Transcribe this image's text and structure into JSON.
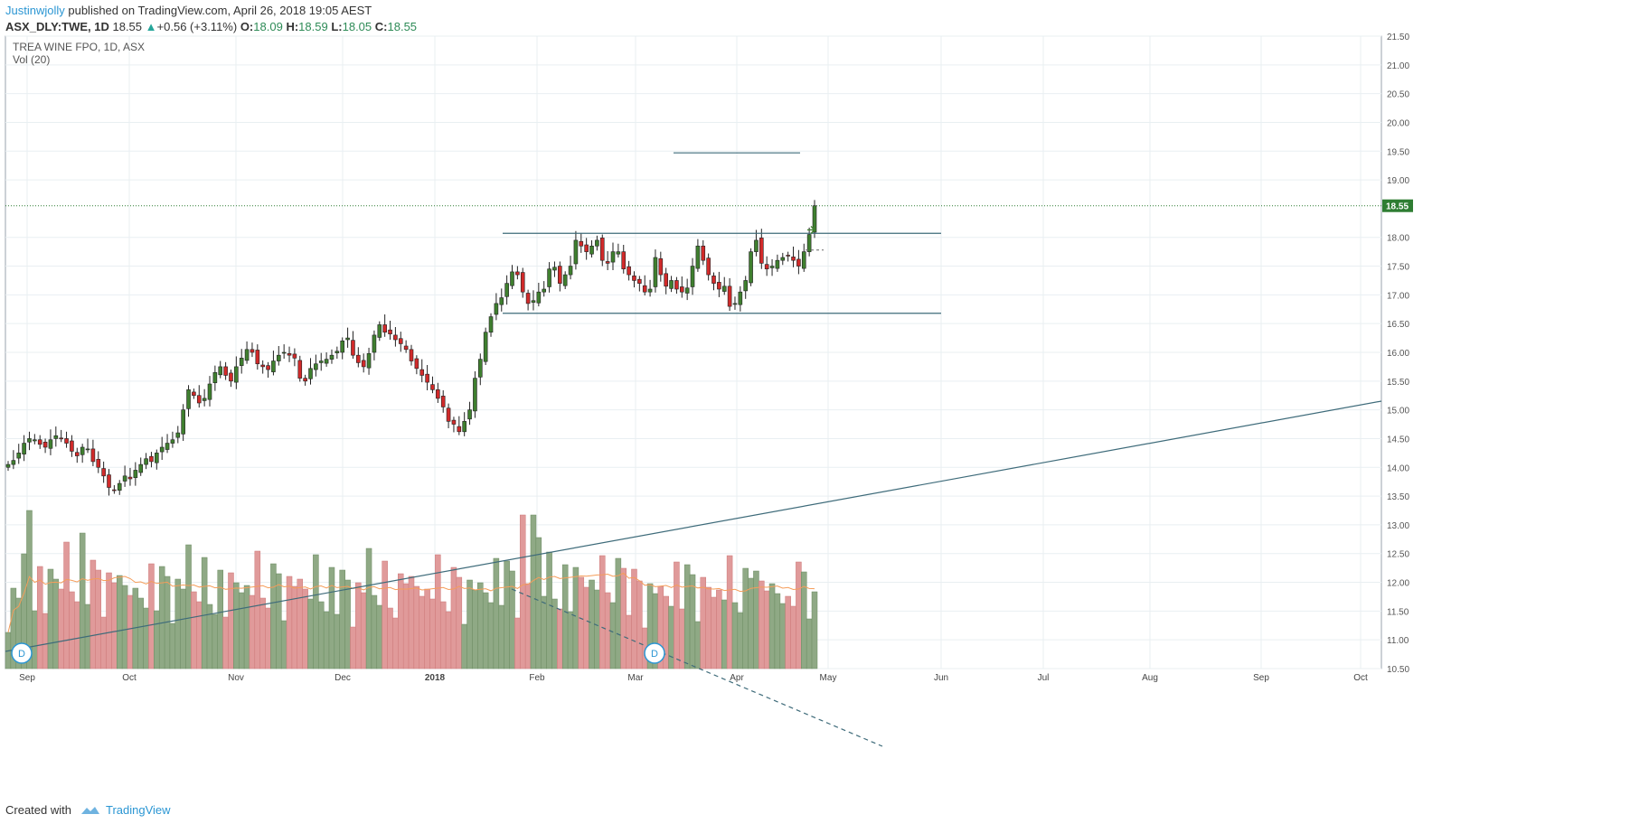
{
  "header": {
    "author": "Justinwjolly",
    "published_text": " published on TradingView.com, April 26, 2018 19:05 AEST",
    "symbol": "ASX_DLY:TWE, 1D",
    "last": "18.55",
    "arrow": "▲",
    "change": "+0.56 (+3.11%)",
    "open_label": "O:",
    "open": "18.09",
    "high_label": "H:",
    "high": "18.59",
    "low_label": "L:",
    "low": "18.05",
    "close_label": "C:",
    "close": "18.55"
  },
  "legend": {
    "title": "TREA WINE FPO, 1D, ASX",
    "volume": "Vol (20)"
  },
  "footer": {
    "created_with": "Created with",
    "brand": "TradingView"
  },
  "colors": {
    "up": "#3f7f2f",
    "down": "#d12a2a",
    "vol_up": "#8fa985",
    "vol_down": "#e09a9a",
    "ma": "#f59d5a",
    "trendline": "#3e6b7a",
    "price_label_bg": "#2e7d32",
    "grid": "#e9eff2"
  },
  "chart_data": {
    "type": "candlestick",
    "title": "TREA WINE FPO, 1D, ASX",
    "ylim": [
      10.5,
      21.5
    ],
    "y_ticks": [
      "21.50",
      "21.00",
      "20.50",
      "20.00",
      "19.50",
      "19.00",
      "18.55",
      "18.00",
      "17.50",
      "17.00",
      "16.50",
      "16.00",
      "15.50",
      "15.00",
      "14.50",
      "14.00",
      "13.50",
      "13.00",
      "12.50",
      "12.00",
      "11.50",
      "11.00",
      "10.50"
    ],
    "x_ticks": [
      "Sep",
      "Oct",
      "Nov",
      "Dec",
      "2018",
      "Feb",
      "Mar",
      "Apr",
      "May",
      "Jun",
      "Jul",
      "Aug",
      "Sep",
      "Oct"
    ],
    "last_price": "18.55",
    "dividend_markers": [
      "D",
      "D"
    ],
    "close": [
      14.05,
      14.12,
      14.25,
      14.42,
      14.5,
      14.48,
      14.4,
      14.35,
      14.48,
      14.55,
      14.5,
      14.42,
      14.28,
      14.2,
      14.35,
      14.32,
      14.1,
      14.0,
      13.85,
      13.65,
      13.6,
      13.72,
      13.85,
      13.8,
      13.95,
      14.05,
      14.15,
      14.1,
      14.25,
      14.35,
      14.42,
      14.48,
      14.6,
      15.0,
      15.35,
      15.25,
      15.12,
      15.2,
      15.45,
      15.65,
      15.75,
      15.6,
      15.5,
      15.75,
      15.9,
      16.05,
      16.0,
      15.8,
      15.75,
      15.7,
      15.85,
      15.95,
      16.0,
      15.95,
      15.9,
      15.55,
      15.5,
      15.72,
      15.8,
      15.85,
      15.88,
      15.95,
      16.02,
      16.2,
      16.25,
      15.95,
      15.82,
      15.75,
      15.98,
      16.3,
      16.48,
      16.35,
      16.32,
      16.22,
      16.15,
      16.05,
      15.85,
      15.72,
      15.6,
      15.48,
      15.35,
      15.2,
      15.05,
      14.8,
      14.75,
      14.62,
      14.8,
      15.0,
      15.55,
      15.88,
      16.35,
      16.62,
      16.85,
      16.95,
      17.2,
      17.4,
      17.35,
      17.05,
      16.85,
      16.9,
      17.05,
      17.1,
      17.45,
      17.48,
      17.2,
      17.35,
      17.5,
      17.95,
      17.85,
      17.75,
      17.85,
      17.95,
      17.6,
      17.55,
      17.75,
      17.75,
      17.45,
      17.35,
      17.25,
      17.2,
      17.05,
      17.1,
      17.65,
      17.35,
      17.15,
      17.25,
      17.1,
      17.05,
      17.12,
      17.5,
      17.85,
      17.6,
      17.35,
      17.2,
      17.1,
      17.15,
      16.8,
      16.85,
      17.05,
      17.25,
      17.75,
      17.95,
      17.55,
      17.45,
      17.5,
      17.6,
      17.65,
      17.68,
      17.6,
      17.5,
      17.75,
      18.05,
      18.55
    ],
    "volume_bars": 164,
    "volume_ma": "Vol (20)",
    "drawings": [
      "horizontal 19.47",
      "horizontal 18.07",
      "horizontal 16.68",
      "rising trendline",
      "dashed falling volume trendline"
    ]
  }
}
